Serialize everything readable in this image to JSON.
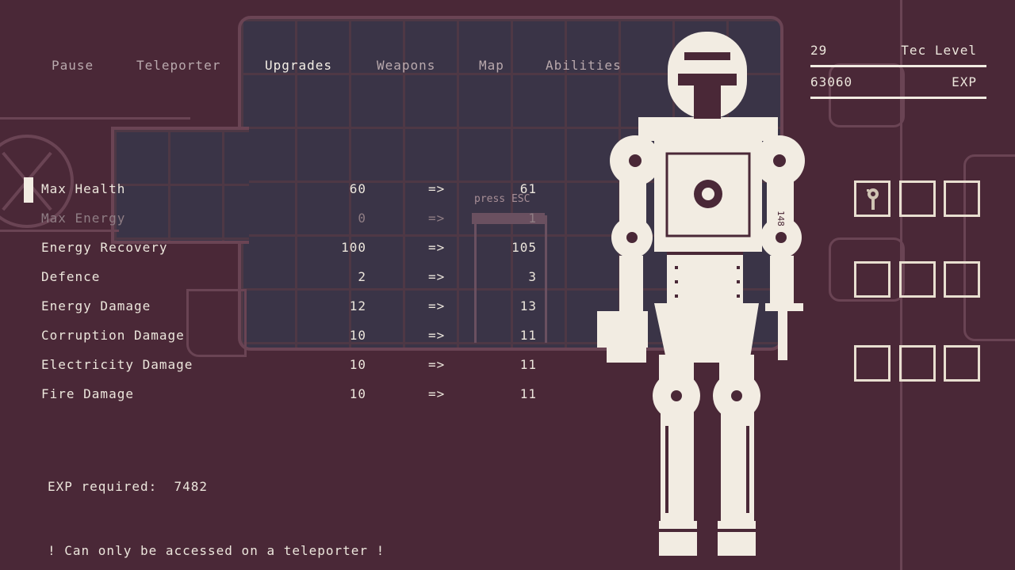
{
  "tabs": [
    {
      "label": "Pause",
      "active": false
    },
    {
      "label": "Teleporter",
      "active": false
    },
    {
      "label": "Upgrades",
      "active": true
    },
    {
      "label": "Weapons",
      "active": false
    },
    {
      "label": "Map",
      "active": false
    },
    {
      "label": "Abilities",
      "active": false
    }
  ],
  "stats": [
    {
      "name": "Max Health",
      "current": "60",
      "arrow": "=>",
      "next": "61",
      "selected": true,
      "disabled": false
    },
    {
      "name": "Max Energy",
      "current": "0",
      "arrow": "=>",
      "next": "1",
      "selected": false,
      "disabled": true
    },
    {
      "name": "Energy Recovery",
      "current": "100",
      "arrow": "=>",
      "next": "105",
      "selected": false,
      "disabled": false
    },
    {
      "name": "Defence",
      "current": "2",
      "arrow": "=>",
      "next": "3",
      "selected": false,
      "disabled": false
    },
    {
      "name": "Energy Damage",
      "current": "12",
      "arrow": "=>",
      "next": "13",
      "selected": false,
      "disabled": false
    },
    {
      "name": "Corruption Damage",
      "current": "10",
      "arrow": "=>",
      "next": "11",
      "selected": false,
      "disabled": false
    },
    {
      "name": "Electricity Damage",
      "current": "10",
      "arrow": "=>",
      "next": "11",
      "selected": false,
      "disabled": false
    },
    {
      "name": "Fire Damage",
      "current": "10",
      "arrow": "=>",
      "next": "11",
      "selected": false,
      "disabled": false
    }
  ],
  "exp_required": {
    "label": "EXP required:",
    "value": "7482"
  },
  "notice": "! Can only be accessed on a teleporter !",
  "info": {
    "tec_level_value": "29",
    "tec_level_label": "Tec Level",
    "exp_value": "63060",
    "exp_label": "EXP"
  },
  "background_hint": "press ESC",
  "robot_label": "148",
  "colors": {
    "background": "#4a2837",
    "text": "#ece6dc",
    "dim_text": "#8f7d84",
    "panel": "#3a3447"
  }
}
